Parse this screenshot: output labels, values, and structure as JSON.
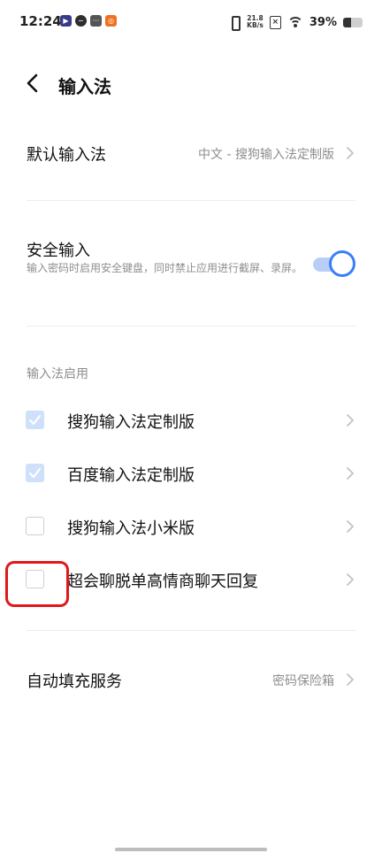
{
  "status_bar": {
    "time": "12:24",
    "net_speed_value": "21.8",
    "net_speed_unit": "KB/s",
    "battery_percent": "39%",
    "battery_level": 0.39,
    "icons": [
      "play-app-icon",
      "leaf-app-icon",
      "dots-app-icon",
      "orange-app-icon",
      "vibrate-icon",
      "sim-x-icon",
      "wifi-icon",
      "battery-icon"
    ]
  },
  "header": {
    "title": "输入法"
  },
  "default_ime": {
    "label": "默认输入法",
    "value": "中文 - 搜狗输入法定制版"
  },
  "secure_input": {
    "label": "安全输入",
    "description": "输入密码时启用安全键盘，同时禁止应用进行截屏、录屏。",
    "enabled": true,
    "accent_color": "#3a7ff6"
  },
  "ime_enabled_section": {
    "title": "输入法启用",
    "items": [
      {
        "label": "搜狗输入法定制版",
        "checked": true
      },
      {
        "label": "百度输入法定制版",
        "checked": true
      },
      {
        "label": "搜狗输入法小米版",
        "checked": false
      },
      {
        "label": "超会聊脱单高情商聊天回复",
        "checked": false
      }
    ]
  },
  "autofill": {
    "label": "自动填充服务",
    "value": "密码保险箱"
  }
}
